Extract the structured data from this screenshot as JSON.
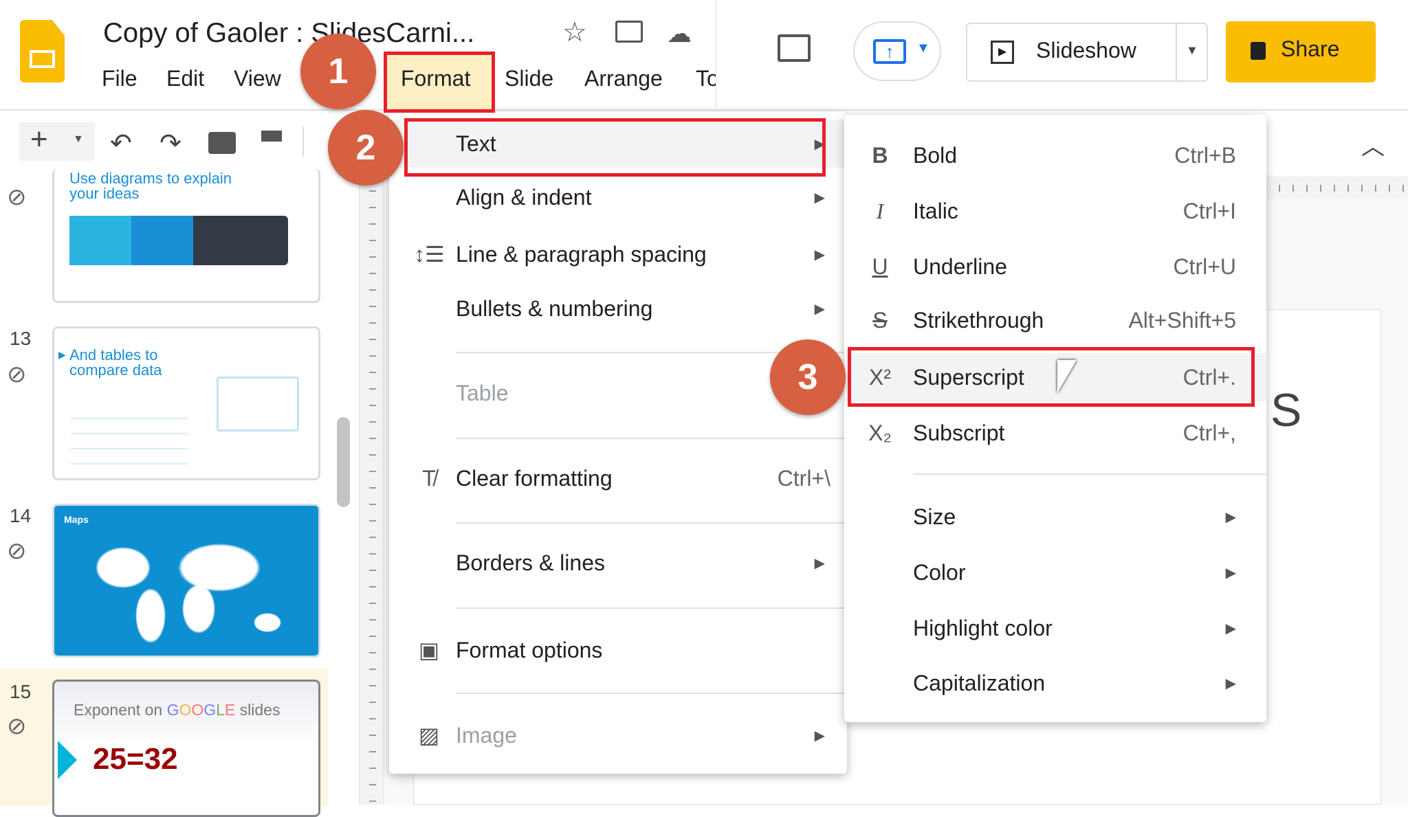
{
  "header": {
    "title": "Copy of Gaoler : SlidesCarni...",
    "menus": [
      "File",
      "Edit",
      "View",
      "Format",
      "Slide",
      "Arrange",
      "To"
    ],
    "active_menu": "Format",
    "slideshow_label": "Slideshow",
    "share_label": "Share",
    "share_color": "#fbbc04"
  },
  "filmstrip": {
    "slides": [
      {
        "number": "",
        "title": "Use diagrams to explain your ideas"
      },
      {
        "number": "13",
        "title": "And tables to compare data"
      },
      {
        "number": "14",
        "title": "Maps"
      },
      {
        "number": "15",
        "title_prefix": "Exponent on",
        "title_brand": [
          "G",
          "O",
          "O",
          "G",
          "L",
          "E"
        ],
        "title_suffix": "slides",
        "formula": "25=32"
      }
    ]
  },
  "format_menu": {
    "items": [
      {
        "label": "Text",
        "icon": "",
        "submenu": true
      },
      {
        "label": "Align & indent",
        "submenu": true
      },
      {
        "label": "Line & paragraph spacing",
        "icon": "line-spacing-icon",
        "submenu": true
      },
      {
        "label": "Bullets & numbering",
        "submenu": true
      },
      {
        "label": "Table",
        "disabled": true
      },
      {
        "label": "Clear formatting",
        "icon": "clear-formatting-icon",
        "shortcut": "Ctrl+\\"
      },
      {
        "label": "Borders & lines",
        "submenu": true
      },
      {
        "label": "Format options",
        "icon": "format-options-icon"
      },
      {
        "label": "Image",
        "icon": "image-icon",
        "submenu": true,
        "disabled": true
      }
    ]
  },
  "text_submenu": {
    "items": [
      {
        "label": "Bold",
        "icon_text": "B",
        "shortcut": "Ctrl+B"
      },
      {
        "label": "Italic",
        "icon_text": "I",
        "shortcut": "Ctrl+I"
      },
      {
        "label": "Underline",
        "icon_text": "U",
        "shortcut": "Ctrl+U"
      },
      {
        "label": "Strikethrough",
        "icon_text": "S",
        "shortcut": "Alt+Shift+5"
      },
      {
        "label": "Superscript",
        "icon_text": "X²",
        "shortcut": "Ctrl+."
      },
      {
        "label": "Subscript",
        "icon_text": "X₂",
        "shortcut": "Ctrl+,"
      },
      {
        "label": "Size",
        "submenu": true
      },
      {
        "label": "Color",
        "submenu": true
      },
      {
        "label": "Highlight color",
        "submenu": true
      },
      {
        "label": "Capitalization",
        "submenu": true
      }
    ]
  },
  "annotations": [
    "1",
    "2",
    "3"
  ],
  "canvas": {
    "partial_text": "S"
  }
}
